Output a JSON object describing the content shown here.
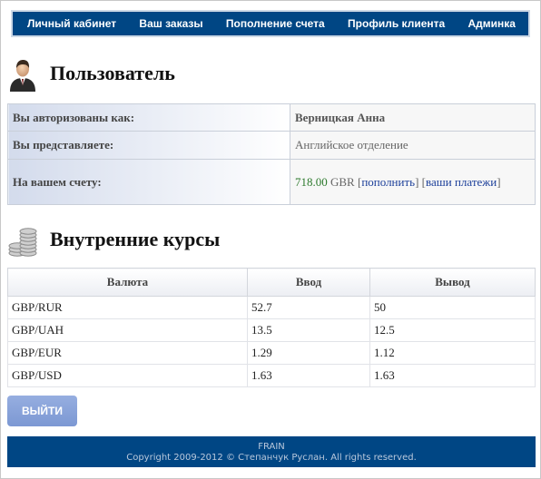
{
  "nav": {
    "items": [
      {
        "label": "Личный кабинет"
      },
      {
        "label": "Ваш заказы"
      },
      {
        "label": "Пополнение счета"
      },
      {
        "label": "Профиль клиента"
      },
      {
        "label": "Админка"
      }
    ]
  },
  "user_section": {
    "title": "Пользователь",
    "icon": "user-icon",
    "rows": [
      {
        "label": "Вы авторизованы как:",
        "value": "Верницкая Анна"
      },
      {
        "label": "Вы представляете:",
        "value": "Английское отделение"
      },
      {
        "label": "На вашем счету:",
        "amount": "718.00",
        "currency": "GBR",
        "topup_link": "пополнить",
        "payments_link": "ваши платежи"
      }
    ]
  },
  "rates_section": {
    "title": "Внутренние курсы",
    "icon": "coins-icon",
    "columns": [
      "Валюта",
      "Ввод",
      "Вывод"
    ],
    "rows": [
      [
        "GBP/RUR",
        "52.7",
        "50"
      ],
      [
        "GBP/UAH",
        "13.5",
        "12.5"
      ],
      [
        "GBP/EUR",
        "1.29",
        "1.12"
      ],
      [
        "GBP/USD",
        "1.63",
        "1.63"
      ]
    ]
  },
  "logout_label": "ВЫЙТИ",
  "footer": {
    "line1": "FRAIN",
    "line2": "Copyright 2009-2012 © Степанчук Руслан. All rights reserved."
  },
  "colors": {
    "nav_bg": "#004684",
    "amount": "#2d7a2d",
    "link": "#1c3f9a",
    "button": "#7c98d3"
  }
}
